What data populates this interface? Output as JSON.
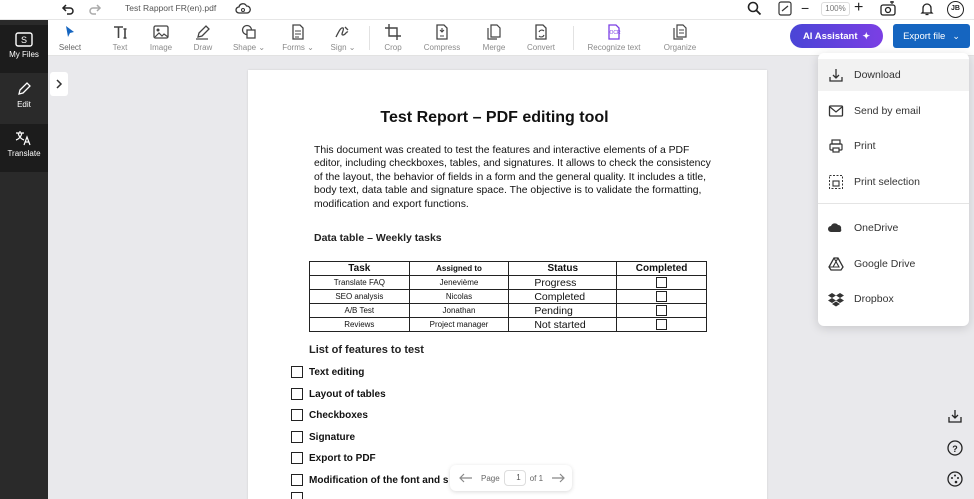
{
  "app": {
    "file_name": "Test Rapport FR(en).pdf",
    "zoom": "100%",
    "user_initials": "JB"
  },
  "nav": {
    "items": [
      {
        "label": "My Files",
        "icon": "files-icon"
      },
      {
        "label": "Edit",
        "icon": "pencil-icon"
      },
      {
        "label": "Translate",
        "icon": "translate-icon"
      }
    ]
  },
  "toolbar": {
    "items": [
      {
        "label": "Select",
        "icon": "cursor-icon"
      },
      {
        "label": "Text",
        "icon": "text-icon"
      },
      {
        "label": "Image",
        "icon": "image-icon"
      },
      {
        "label": "Draw",
        "icon": "draw-icon"
      },
      {
        "label": "Shape",
        "icon": "shape-icon",
        "has_dropdown": true
      },
      {
        "label": "Forms",
        "icon": "forms-icon",
        "has_dropdown": true
      },
      {
        "label": "Sign",
        "icon": "sign-icon",
        "has_dropdown": true
      },
      {
        "label": "Crop",
        "icon": "crop-icon"
      },
      {
        "label": "Compress",
        "icon": "compress-icon"
      },
      {
        "label": "Merge",
        "icon": "merge-icon"
      },
      {
        "label": "Convert",
        "icon": "convert-icon"
      },
      {
        "label": "Recognize text",
        "icon": "ocr-icon"
      },
      {
        "label": "Organize",
        "icon": "organize-icon"
      }
    ],
    "ai_label": "AI Assistant",
    "export_label": "Export file"
  },
  "export_menu": {
    "items": [
      {
        "label": "Download",
        "icon": "download-icon"
      },
      {
        "label": "Send by email",
        "icon": "email-icon"
      },
      {
        "label": "Print",
        "icon": "print-icon"
      },
      {
        "label": "Print selection",
        "icon": "print-selection-icon"
      },
      {
        "label": "OneDrive",
        "icon": "onedrive-icon"
      },
      {
        "label": "Google Drive",
        "icon": "google-drive-icon"
      },
      {
        "label": "Dropbox",
        "icon": "dropbox-icon"
      }
    ]
  },
  "document": {
    "title": "Test Report – PDF editing tool",
    "body": "This document was created to test the features and interactive elements of a PDF editor, including checkboxes, tables, and signatures. It allows to check the consistency of the layout, the behavior of fields in a form and the general quality. It includes a title, body text, data table and signature space. The objective is to validate the formatting, modification and export functions.",
    "table_heading": "Data table – Weekly tasks",
    "table": {
      "headers": [
        "Task",
        "Assigned to",
        "Status",
        "Completed"
      ],
      "rows": [
        [
          "Translate FAQ",
          "Jenevième",
          "Progress"
        ],
        [
          "SEO analysis",
          "Nicolas",
          "Completed"
        ],
        [
          "A/B Test",
          "Jonathan",
          "Pending"
        ],
        [
          "Reviews",
          "Project manager",
          "Not started"
        ]
      ]
    },
    "features_heading": "List of features to test",
    "features": [
      "Text editing",
      "Layout of tables",
      "Checkboxes",
      "Signature",
      "Export to PDF",
      "Modification of the font and s"
    ]
  },
  "pagination": {
    "page_label": "Page",
    "current_page": "1",
    "of_label": "of 1"
  },
  "colors": {
    "sidebar": "#2a2a2a",
    "export_button": "#1565c0",
    "ai_gradient_start": "#4a45d6",
    "ai_gradient_end": "#7b3fe4"
  }
}
